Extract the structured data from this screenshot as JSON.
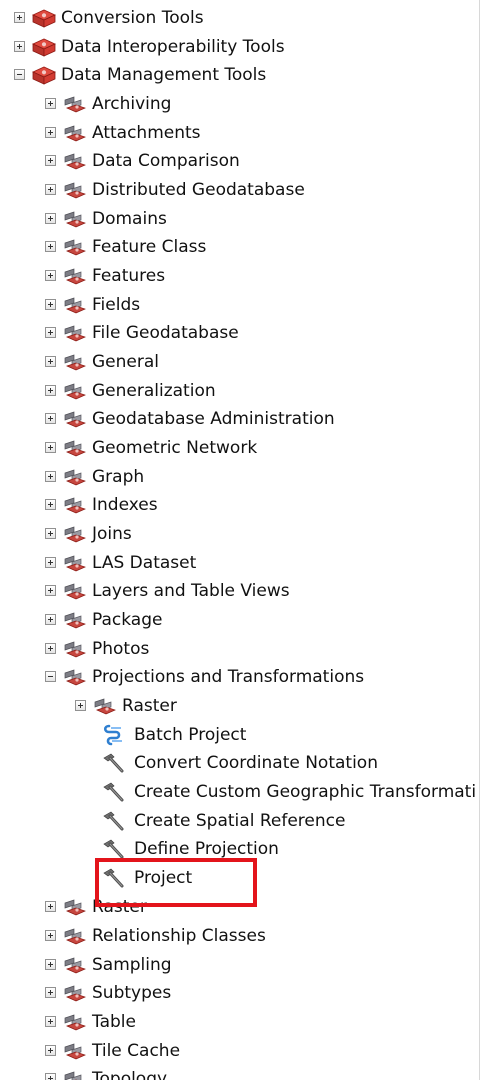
{
  "tree": {
    "toolbox_conversion": "Conversion Tools",
    "toolbox_data_interop": "Data Interoperability Tools",
    "toolbox_data_management": "Data Management Tools",
    "toolsets": {
      "archiving": "Archiving",
      "attachments": "Attachments",
      "data_comparison": "Data Comparison",
      "distributed_geodatabase": "Distributed Geodatabase",
      "domains": "Domains",
      "feature_class": "Feature Class",
      "features": "Features",
      "fields": "Fields",
      "file_geodatabase": "File Geodatabase",
      "general": "General",
      "generalization": "Generalization",
      "geodatabase_administration": "Geodatabase Administration",
      "geometric_network": "Geometric Network",
      "graph": "Graph",
      "indexes": "Indexes",
      "joins": "Joins",
      "las_dataset": "LAS Dataset",
      "layers_table_views": "Layers and Table Views",
      "package": "Package",
      "photos": "Photos",
      "projections_transformations": "Projections and Transformations",
      "raster": "Raster",
      "relationship_classes": "Relationship Classes",
      "sampling": "Sampling",
      "subtypes": "Subtypes",
      "table": "Table",
      "tile_cache": "Tile Cache",
      "topology": "Topology"
    },
    "projections_children": {
      "raster": "Raster",
      "batch_project": "Batch Project",
      "convert_coordinate_notation": "Convert Coordinate Notation",
      "create_custom_geographic_transformation": "Create Custom Geographic Transformati",
      "create_spatial_reference": "Create Spatial Reference",
      "define_projection": "Define Projection",
      "project": "Project"
    }
  },
  "highlight_color": "#e3141b",
  "icons": {
    "top_toolbox": "red-toolbox-icon",
    "toolset": "toolset-icon",
    "script_tool": "script-tool-icon",
    "tool": "hammer-tool-icon"
  }
}
